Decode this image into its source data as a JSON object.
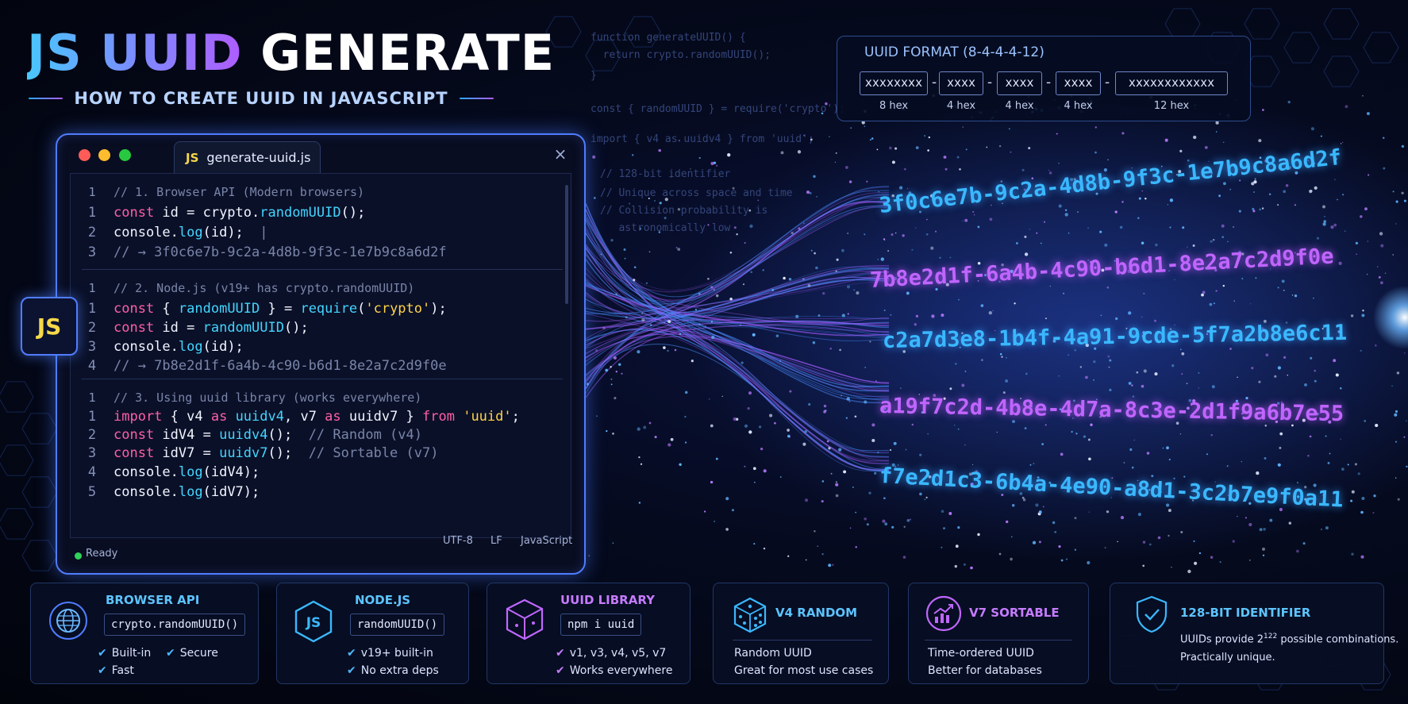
{
  "header": {
    "title_accent": "JS UUID",
    "title_plain": "GENERATE",
    "subtitle": "HOW TO CREATE UUID IN JAVASCRIPT"
  },
  "editor": {
    "filename": "generate-uuid.js",
    "tab_badge": "JS",
    "close_icon": "×",
    "status": {
      "ready": "Ready",
      "encoding": "UTF-8",
      "eol": "LF",
      "language": "JavaScript"
    },
    "blocks": [
      {
        "comment": {
          "ln": "1",
          "text": "// 1. Browser API (Modern browsers)"
        },
        "lines": [
          {
            "ln": "1",
            "parts": [
              [
                "kw",
                "const "
              ],
              [
                "pl",
                "id = crypto."
              ],
              [
                "fn",
                "randomUUID"
              ],
              [
                "pl",
                "();"
              ]
            ]
          },
          {
            "ln": "2",
            "parts": [
              [
                "pl",
                "console."
              ],
              [
                "fn",
                "log"
              ],
              [
                "pl",
                "(id);  "
              ],
              [
                "cmt",
                "|"
              ]
            ]
          },
          {
            "ln": "3",
            "parts": [
              [
                "cmt",
                "// → 3f0c6e7b-9c2a-4d8b-9f3c-1e7b9c8a6d2f"
              ]
            ]
          }
        ]
      },
      {
        "comment": {
          "ln": "1",
          "text": "// 2. Node.js (v19+ has crypto.randomUUID)"
        },
        "lines": [
          {
            "ln": "1",
            "parts": [
              [
                "kw",
                "const "
              ],
              [
                "pl",
                "{ "
              ],
              [
                "fn",
                "randomUUID"
              ],
              [
                "pl",
                " } = "
              ],
              [
                "fn",
                "require"
              ],
              [
                "pl",
                "("
              ],
              [
                "str",
                "'crypto'"
              ],
              [
                "pl",
                ");"
              ]
            ]
          },
          {
            "ln": "2",
            "parts": [
              [
                "kw",
                "const "
              ],
              [
                "pl",
                "id = "
              ],
              [
                "fn",
                "randomUUID"
              ],
              [
                "pl",
                "();"
              ]
            ]
          },
          {
            "ln": "3",
            "parts": [
              [
                "pl",
                "console."
              ],
              [
                "fn",
                "log"
              ],
              [
                "pl",
                "(id);"
              ]
            ]
          },
          {
            "ln": "4",
            "parts": [
              [
                "cmt",
                "// → 7b8e2d1f-6a4b-4c90-b6d1-8e2a7c2d9f0e"
              ]
            ]
          }
        ]
      },
      {
        "comment": {
          "ln": "1",
          "text": "// 3. Using uuid library (works everywhere)"
        },
        "lines": [
          {
            "ln": "1",
            "parts": [
              [
                "kw",
                "import "
              ],
              [
                "pl",
                "{ v4 "
              ],
              [
                "kw",
                "as "
              ],
              [
                "fn",
                "uuidv4"
              ],
              [
                "pl",
                ", v7 "
              ],
              [
                "kw",
                "as "
              ],
              [
                "pl",
                "uuidv7 } "
              ],
              [
                "kw",
                "from "
              ],
              [
                "str",
                "'uuid'"
              ],
              [
                "pl",
                ";"
              ]
            ]
          },
          {
            "ln": "2",
            "parts": [
              [
                "kw",
                "const "
              ],
              [
                "pl",
                "idV4 = "
              ],
              [
                "fn",
                "uuidv4"
              ],
              [
                "pl",
                "();  "
              ],
              [
                "cmt",
                "// Random (v4)"
              ]
            ]
          },
          {
            "ln": "3",
            "parts": [
              [
                "kw",
                "const "
              ],
              [
                "pl",
                "idV7 = "
              ],
              [
                "fn",
                "uuidv7"
              ],
              [
                "pl",
                "();  "
              ],
              [
                "cmt",
                "// Sortable (v7)"
              ]
            ]
          },
          {
            "ln": "4",
            "parts": [
              [
                "pl",
                "console."
              ],
              [
                "fn",
                "log"
              ],
              [
                "pl",
                "(idV4);"
              ]
            ]
          },
          {
            "ln": "5",
            "parts": [
              [
                "pl",
                "console."
              ],
              [
                "fn",
                "log"
              ],
              [
                "pl",
                "(idV7);"
              ]
            ]
          }
        ]
      }
    ]
  },
  "side_badge": "JS",
  "background_code": [
    "function generateUUID() {",
    "  return crypto.randomUUID();",
    "}",
    "const { randomUUID } = require('crypto');",
    "import { v4 as uuidv4 } from 'uuid';",
    "// 128-bit identifier",
    "// Unique across space and time",
    "// Collision probability is",
    "   astronomically low"
  ],
  "uuid_format": {
    "title": "UUID FORMAT (8-4-4-4-12)",
    "segments": [
      {
        "text": "xxxxxxxx",
        "label": "8 hex"
      },
      {
        "text": "xxxx",
        "label": "4 hex"
      },
      {
        "text": "xxxx",
        "label": "4 hex"
      },
      {
        "text": "xxxx",
        "label": "4 hex"
      },
      {
        "text": "xxxxxxxxxxxx",
        "label": "12 hex"
      }
    ],
    "dash": "-"
  },
  "uuid_stream": [
    {
      "value": "3f0c6e7b-9c2a-4d8b-9f3c-1e7b9c8a6d2f",
      "color": "#3ab8ff"
    },
    {
      "value": "7b8e2d1f-6a4b-4c90-b6d1-8e2a7c2d9f0e",
      "color": "#c065ff"
    },
    {
      "value": "c2a7d3e8-1b4f-4a91-9cde-5f7a2b8e6c11",
      "color": "#3ab8ff"
    },
    {
      "value": "a19f7c2d-4b8e-4d7a-8c3e-2d1f9a6b7e55",
      "color": "#c065ff"
    },
    {
      "value": "f7e2d1c3-6b4a-4e90-a8d1-3c2b7e9f0a11",
      "color": "#3ab8ff"
    }
  ],
  "cards": [
    {
      "icon": "globe-icon",
      "title": "BROWSER API",
      "code": "crypto.randomUUID()",
      "items": [
        "Built-in",
        "Secure",
        "Fast"
      ]
    },
    {
      "icon": "nodejs-hexagon-icon",
      "title": "NODE.JS",
      "code": "randomUUID()",
      "items": [
        "v19+ built-in",
        "No extra deps"
      ]
    },
    {
      "icon": "package-box-icon",
      "title": "UUID LIBRARY",
      "code": "npm i uuid",
      "items": [
        "v1, v3, v4, v5, v7",
        "Works everywhere"
      ]
    },
    {
      "icon": "dice-icon",
      "title": "V4 RANDOM",
      "lines": [
        "Random UUID",
        "Great for most use cases"
      ]
    },
    {
      "icon": "trending-chart-icon",
      "title": "V7 SORTABLE",
      "lines": [
        "Time-ordered UUID",
        "Better for databases"
      ]
    },
    {
      "icon": "shield-check-icon",
      "title": "128-BIT IDENTIFIER",
      "line1_pre": "UUIDs provide 2",
      "line1_sup": "122",
      "line1_post": " possible combinations.",
      "line2": "Practically unique."
    }
  ],
  "colors": {
    "accent_blue": "#3ab8ff",
    "accent_purple": "#c065ff",
    "keyword_pink": "#ff5fa8",
    "string_yellow": "#ffd34a",
    "frame_blue": "#4f7dff"
  }
}
